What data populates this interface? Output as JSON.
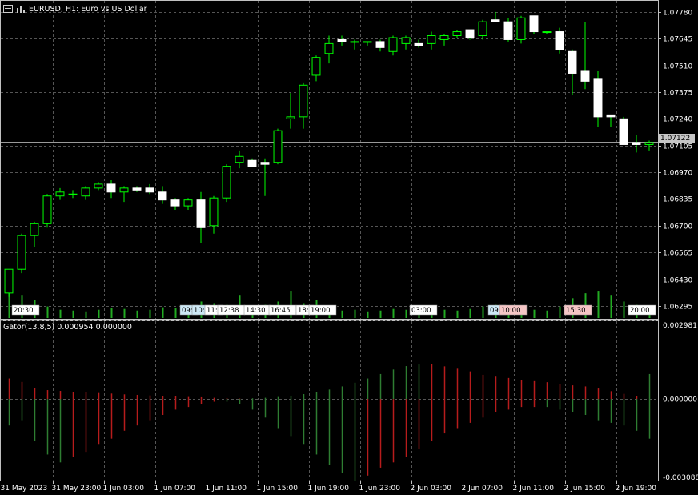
{
  "header": {
    "symbol_title": "EURUSD, H1:  Euro vs US Dollar"
  },
  "indicator": {
    "label": "Gator(13,8,5) 0.000954 0.000000"
  },
  "current_price": "1.07122",
  "colors": {
    "background": "#000000",
    "grid": "#555555",
    "bull": "#00ff00",
    "bear": "#ffffff",
    "gator_up": "#2e7d32",
    "gator_down": "#b71c1c",
    "volume": "#22aa22",
    "price_line": "#9a9a9a"
  },
  "events": [
    {
      "label": "20:30",
      "color": "#ffffff"
    },
    {
      "label": "09:",
      "color": "#cde8f5"
    },
    {
      "label": "10:",
      "color": "#cde8f5"
    },
    {
      "label": "11:",
      "color": "#ffffff"
    },
    {
      "label": "12:38",
      "color": "#ffffff"
    },
    {
      "label": "14:30",
      "color": "#ffffff"
    },
    {
      "label": "16:45",
      "color": "#ffffff"
    },
    {
      "label": "18:",
      "color": "#ffffff"
    },
    {
      "label": "19:00",
      "color": "#ffffff"
    },
    {
      "label": "03:00",
      "color": "#ffffff"
    },
    {
      "label": "09:",
      "color": "#cde8f5"
    },
    {
      "label": "10:00",
      "color": "#f5c6c6"
    },
    {
      "label": "15:30",
      "color": "#f5c6c6"
    },
    {
      "label": "20:00",
      "color": "#ffffff"
    }
  ],
  "chart_data": [
    {
      "type": "candlestick",
      "title": "EURUSD, H1:  Euro vs US Dollar",
      "ylim": [
        1.0623,
        1.0784
      ],
      "y_ticks": [
        "1.07780",
        "1.07645",
        "1.07510",
        "1.07375",
        "1.07240",
        "1.07105",
        "1.06970",
        "1.06835",
        "1.06700",
        "1.06565",
        "1.06430",
        "1.06295"
      ],
      "x_ticks": [
        "31 May 2023",
        "31 May 23:00",
        "1 Jun 03:00",
        "1 Jun 07:00",
        "1 Jun 11:00",
        "1 Jun 15:00",
        "1 Jun 19:00",
        "1 Jun 23:00",
        "2 Jun 03:00",
        "2 Jun 07:00",
        "2 Jun 11:00",
        "2 Jun 15:00",
        "2 Jun 19:00"
      ],
      "grid": true,
      "ohlc": [
        [
          1.0636,
          1.0648,
          1.0634,
          1.0648
        ],
        [
          1.0648,
          1.0666,
          1.0646,
          1.0665
        ],
        [
          1.0665,
          1.0672,
          1.0659,
          1.0671
        ],
        [
          1.0671,
          1.0686,
          1.0669,
          1.0685
        ],
        [
          1.0685,
          1.0689,
          1.0683,
          1.0687
        ],
        [
          1.0686,
          1.0688,
          1.0684,
          1.0686
        ],
        [
          1.0685,
          1.069,
          1.0683,
          1.0689
        ],
        [
          1.0689,
          1.0692,
          1.0688,
          1.0691
        ],
        [
          1.0691,
          1.0693,
          1.0684,
          1.0687
        ],
        [
          1.0687,
          1.069,
          1.0682,
          1.0689
        ],
        [
          1.0689,
          1.069,
          1.0687,
          1.0688
        ],
        [
          1.0689,
          1.0691,
          1.0686,
          1.0687
        ],
        [
          1.0687,
          1.069,
          1.0681,
          1.0683
        ],
        [
          1.0683,
          1.0684,
          1.0678,
          1.068
        ],
        [
          1.068,
          1.0684,
          1.0678,
          1.0683
        ],
        [
          1.0683,
          1.0687,
          1.0661,
          1.0669
        ],
        [
          1.067,
          1.0685,
          1.0666,
          1.0684
        ],
        [
          1.0684,
          1.0701,
          1.0682,
          1.07
        ],
        [
          1.0702,
          1.0708,
          1.0699,
          1.0705
        ],
        [
          1.0703,
          1.0704,
          1.07,
          1.07
        ],
        [
          1.0702,
          1.0704,
          1.0685,
          1.0701
        ],
        [
          1.0702,
          1.0719,
          1.0701,
          1.0718
        ],
        [
          1.0724,
          1.0737,
          1.0719,
          1.0725
        ],
        [
          1.0725,
          1.0742,
          1.0719,
          1.0741
        ],
        [
          1.0746,
          1.0756,
          1.0743,
          1.0755
        ],
        [
          1.0757,
          1.0766,
          1.0752,
          1.0762
        ],
        [
          1.0764,
          1.0766,
          1.0761,
          1.0763
        ],
        [
          1.0763,
          1.0764,
          1.0759,
          1.0763
        ],
        [
          1.0763,
          1.0763,
          1.0761,
          1.0763
        ],
        [
          1.0763,
          1.0764,
          1.0758,
          1.076
        ],
        [
          1.0758,
          1.0766,
          1.0756,
          1.0765
        ],
        [
          1.0762,
          1.0766,
          1.0759,
          1.0765
        ],
        [
          1.0762,
          1.0764,
          1.076,
          1.0761
        ],
        [
          1.0762,
          1.0768,
          1.0759,
          1.0766
        ],
        [
          1.0764,
          1.0767,
          1.0761,
          1.0766
        ],
        [
          1.0766,
          1.0769,
          1.0765,
          1.0768
        ],
        [
          1.0769,
          1.0769,
          1.0764,
          1.0765
        ],
        [
          1.0766,
          1.0774,
          1.0764,
          1.0773
        ],
        [
          1.0774,
          1.0778,
          1.0773,
          1.0773
        ],
        [
          1.0773,
          1.0775,
          1.0763,
          1.0764
        ],
        [
          1.0764,
          1.0776,
          1.0762,
          1.0775
        ],
        [
          1.0776,
          1.0776,
          1.0767,
          1.0768
        ],
        [
          1.0768,
          1.0768,
          1.0767,
          1.0768
        ],
        [
          1.0768,
          1.077,
          1.0757,
          1.0759
        ],
        [
          1.0758,
          1.0759,
          1.0736,
          1.0747
        ],
        [
          1.0748,
          1.0773,
          1.0739,
          1.0743
        ],
        [
          1.0744,
          1.0748,
          1.072,
          1.0725
        ],
        [
          1.0726,
          1.0726,
          1.072,
          1.0725
        ],
        [
          1.0724,
          1.0725,
          1.0711,
          1.0711
        ],
        [
          1.0712,
          1.0716,
          1.0707,
          1.0711
        ],
        [
          1.0711,
          1.0713,
          1.0708,
          1.0712
        ]
      ],
      "volume": [
        30,
        28,
        22,
        14,
        10,
        9,
        8,
        10,
        12,
        11,
        9,
        10,
        13,
        12,
        11,
        20,
        18,
        16,
        28,
        14,
        16,
        20,
        33,
        18,
        22,
        14,
        9,
        10,
        8,
        9,
        11,
        10,
        9,
        12,
        10,
        9,
        11,
        14,
        16,
        13,
        12,
        10,
        9,
        14,
        24,
        30,
        33,
        28,
        20,
        16,
        12
      ]
    },
    {
      "type": "bar",
      "title": "Gator(13,8,5)",
      "ylim": [
        -0.003088,
        0.002981
      ],
      "y_ticks": [
        "0.002981",
        "0.000000",
        "-0.003088"
      ],
      "upper": [
        0.00078,
        0.00065,
        0.00042,
        0.00034,
        0.00031,
        0.00028,
        0.00025,
        0.00023,
        0.00021,
        0.00018,
        0.00016,
        0.00014,
        0.00012,
        0.0001,
        8e-05,
        7e-05,
        5e-05,
        4e-05,
        2e-05,
        3e-05,
        5e-05,
        8e-05,
        0.00013,
        0.00019,
        0.00027,
        0.00036,
        0.00048,
        0.00062,
        0.00078,
        0.00095,
        0.00112,
        0.00125,
        0.00131,
        0.00132,
        0.00124,
        0.00115,
        0.00105,
        0.00092,
        0.00085,
        0.0008,
        0.00072,
        0.00068,
        0.00064,
        0.00058,
        0.00052,
        0.00048,
        0.0004,
        0.0003,
        0.0002,
        0.00012,
        0.00095
      ],
      "upper_up": [
        false,
        false,
        false,
        false,
        false,
        false,
        false,
        false,
        false,
        false,
        false,
        false,
        false,
        false,
        false,
        false,
        false,
        false,
        false,
        true,
        true,
        true,
        true,
        true,
        true,
        true,
        true,
        true,
        true,
        true,
        true,
        true,
        true,
        false,
        false,
        false,
        false,
        false,
        false,
        false,
        false,
        false,
        false,
        false,
        false,
        false,
        false,
        false,
        false,
        false,
        true
      ],
      "lower": [
        0.001,
        0.0008,
        0.0016,
        0.0021,
        0.0024,
        0.0022,
        0.002,
        0.0017,
        0.0015,
        0.0012,
        0.001,
        0.0008,
        0.0006,
        0.0004,
        0.0003,
        0.0002,
        0.0001,
        0.0001,
        0.0002,
        0.0004,
        0.0007,
        0.0011,
        0.0014,
        0.0017,
        0.0021,
        0.0025,
        0.0028,
        0.0031,
        0.0029,
        0.0026,
        0.0024,
        0.0022,
        0.0019,
        0.0016,
        0.0013,
        0.0011,
        0.0009,
        0.0007,
        0.0005,
        0.0004,
        0.0003,
        0.0003,
        0.0003,
        0.0004,
        0.0005,
        0.0006,
        0.0008,
        0.0009,
        0.001,
        0.0012,
        0.0015
      ],
      "lower_up": [
        true,
        true,
        true,
        true,
        true,
        false,
        false,
        false,
        false,
        false,
        false,
        false,
        false,
        false,
        false,
        false,
        false,
        true,
        true,
        true,
        true,
        true,
        true,
        true,
        true,
        true,
        true,
        true,
        false,
        false,
        false,
        false,
        false,
        false,
        false,
        false,
        false,
        false,
        false,
        false,
        false,
        false,
        true,
        true,
        true,
        true,
        true,
        true,
        true,
        true,
        true
      ],
      "grid": true
    }
  ]
}
